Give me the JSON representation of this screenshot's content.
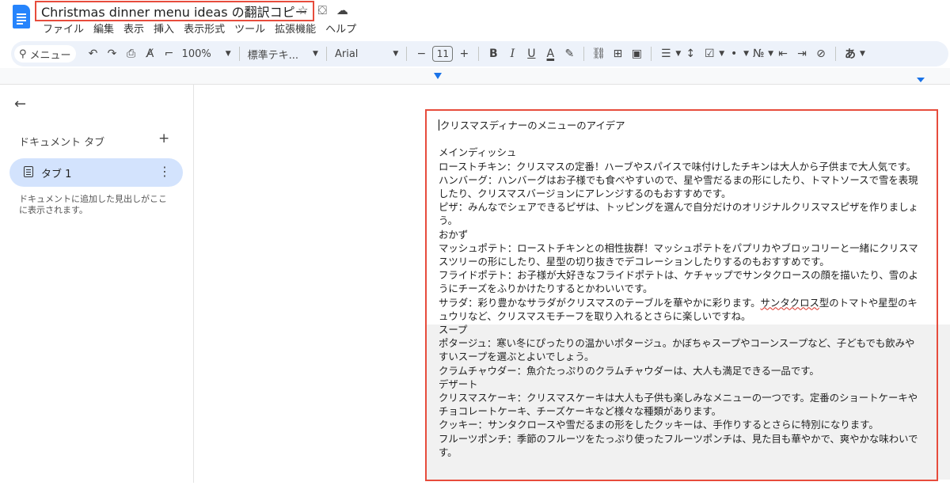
{
  "title_bar": {
    "doc_title": "Christmas dinner menu ideas の翻訳コピー",
    "star_icon": "☆",
    "move_icon": "⛋",
    "cloud_icon": "☁"
  },
  "menu": [
    "ファイル",
    "編集",
    "表示",
    "挿入",
    "表示形式",
    "ツール",
    "拡張機能",
    "ヘルプ"
  ],
  "toolbar": {
    "search_label": "メニュー",
    "zoom": "100%",
    "style": "標準テキ...",
    "font": "Arial",
    "font_size": "11",
    "input_tool": "あ"
  },
  "sidebar": {
    "tabs_header": "ドキュメント タブ",
    "tab_label": "タブ 1",
    "outline_hint": "ドキュメントに追加した見出しがここに表示されます。"
  },
  "document": {
    "heading": "クリスマスディナーのメニューのアイデア",
    "lines": [
      "メインディッシュ",
      "ローストチキン：クリスマスの定番！ハーブやスパイスで味付けしたチキンは大人から子供まで大人気です。",
      "ハンバーグ：ハンバーグはお子様でも食べやすいので、星や雪だるまの形にしたり、トマトソースで雪を表現したり、クリスマスバージョンにアレンジするのもおすすめです。",
      "ピザ：みんなでシェアできるピザは、トッピングを選んで自分だけのオリジナルクリスマスピザを作りましょう。",
      "おかず",
      "マッシュポテト：ローストチキンとの相性抜群！マッシュポテトをパプリカやブロッコリーと一緒にクリスマスツリーの形にしたり、星型の切り抜きでデコレーションしたりするのもおすすめです。",
      "フライドポテト：お子様が大好きなフライドポテトは、ケチャップでサンタクロースの顔を描いたり、雪のようにチーズをふりかけたりするとかわいいです。"
    ],
    "salad_before": "サラダ：彩り豊かなサラダがクリスマスのテーブルを華やかに彩ります。",
    "salad_spell": "サンタクロス",
    "salad_after": "型のトマトや星型のキュウリなど、クリスマスモチーフを取り入れるとさらに楽しいですね。",
    "lines_after": [
      "スープ",
      "ポタージュ：寒い冬にぴったりの温かいポタージュ。かぼちゃスープやコーンスープなど、子どもでも飲みやすいスープを選ぶとよいでしょう。",
      "クラムチャウダー：魚介たっぷりのクラムチャウダーは、大人も満足できる一品です。",
      "デザート",
      "クリスマスケーキ：クリスマスケーキは大人も子供も楽しみなメニューの一つです。定番のショートケーキやチョコレートケーキ、チーズケーキなど様々な種類があります。",
      "クッキー：サンタクロースや雪だるまの形をしたクッキーは、手作りするとさらに特別になります。",
      "フルーツポンチ：季節のフルーツをたっぷり使ったフルーツポンチは、見た目も華やかで、爽やかな味わいです。"
    ]
  },
  "colors": {
    "accent_blue": "#1a73e8",
    "highlight_red": "#e74c3c",
    "toolbar_bg": "#edf2fa",
    "tab_selected": "#d3e3fd"
  }
}
